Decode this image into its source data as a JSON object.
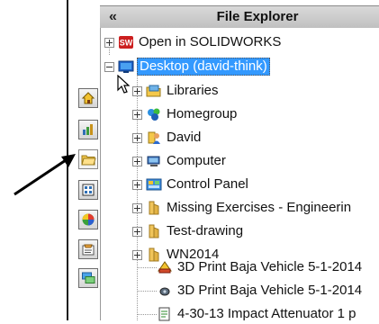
{
  "header": {
    "collapse_glyph": "«",
    "title": "File Explorer"
  },
  "side_tabs": [
    {
      "icon": "home-icon"
    },
    {
      "icon": "resources-icon"
    },
    {
      "icon": "folder-icon",
      "active": true
    },
    {
      "icon": "view-palette-icon"
    },
    {
      "icon": "appearances-icon"
    },
    {
      "icon": "custom-properties-icon"
    },
    {
      "icon": "forum-icon"
    }
  ],
  "tree": {
    "open_in_solidworks": "Open in SOLIDWORKS",
    "desktop": "Desktop (david-think)",
    "libraries": "Libraries",
    "homegroup": "Homegroup",
    "david": "David",
    "computer": "Computer",
    "control_panel": "Control Panel",
    "missing_exercises": "Missing Exercises - Engineerin",
    "test_drawing": "Test-drawing",
    "wn2014": "WN2014",
    "file1": "3D Print Baja Vehicle 5-1-2014",
    "file2": "3D Print Baja Vehicle 5-1-2014",
    "file3": "4-30-13 Impact Attenuator 1 p"
  },
  "colors": {
    "selection": "#3399ff",
    "accent_red": "#cc1f1f"
  }
}
